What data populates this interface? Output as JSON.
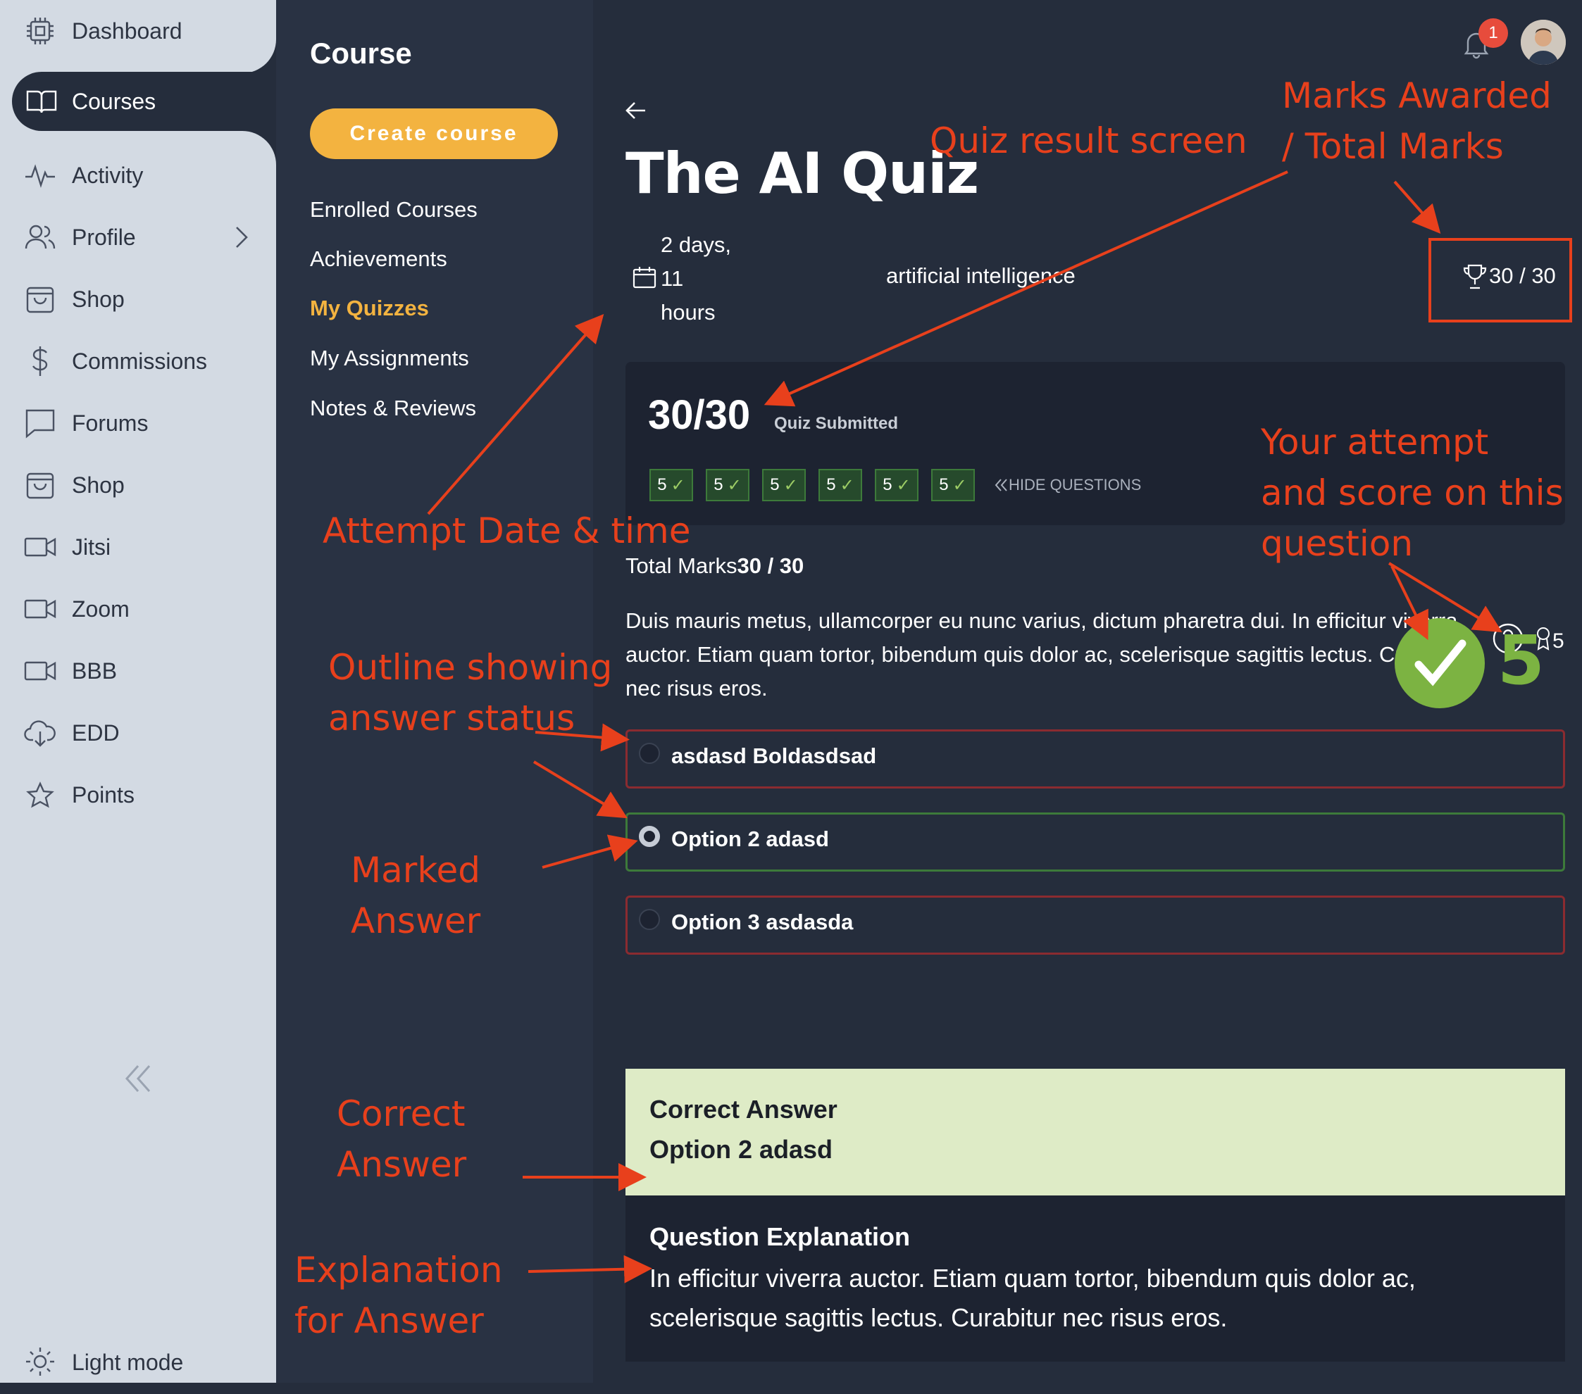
{
  "sidebar": {
    "items": [
      {
        "label": "Dashboard",
        "icon": "chip-icon"
      },
      {
        "label": "Courses",
        "icon": "book-icon",
        "active": true
      },
      {
        "label": "Activity",
        "icon": "pulse-icon"
      },
      {
        "label": "Profile",
        "icon": "users-icon",
        "chevron": "chevron-right-icon"
      },
      {
        "label": "Shop",
        "icon": "bag-icon"
      },
      {
        "label": "Commissions",
        "icon": "dollar-icon"
      },
      {
        "label": "Forums",
        "icon": "chat-icon"
      },
      {
        "label": "Shop",
        "icon": "bag-icon"
      },
      {
        "label": "Jitsi",
        "icon": "video-icon"
      },
      {
        "label": "Zoom",
        "icon": "video-icon"
      },
      {
        "label": "BBB",
        "icon": "video-icon"
      },
      {
        "label": "EDD",
        "icon": "cloud-download-icon"
      },
      {
        "label": "Points",
        "icon": "star-icon"
      }
    ],
    "collapse_icon": "double-chevron-left-icon",
    "light_mode_label": "Light mode"
  },
  "course_menu": {
    "title": "Course",
    "create_button": "Create course",
    "links": [
      "Enrolled Courses",
      "Achievements",
      "My Quizzes",
      "My Assignments",
      "Notes & Reviews"
    ],
    "active_link": "My Quizzes"
  },
  "header": {
    "notification_count": "1"
  },
  "quiz": {
    "title": "The AI Quiz",
    "date_lines": [
      "2 days,",
      "11",
      "hours"
    ],
    "category": "artificial intelligence",
    "marks": "30 / 30",
    "score": "30/30",
    "status": "Quiz Submitted",
    "chips": [
      "5",
      "5",
      "5",
      "5",
      "5",
      "5"
    ],
    "hide_questions": "HIDE QUESTIONS",
    "total_marks_label": "Total Marks",
    "total_marks_value": "30 / 30",
    "question_text": "Duis mauris metus, ullamcorper eu nunc varius, dictum pharetra dui. In efficitur viverra auctor. Etiam quam tortor, bibendum quis dolor ac, scelerisque sagittis lectus. Curabitur nec risus eros.",
    "question_points": "5",
    "big_score": "5",
    "options": [
      {
        "text": "asdasd Boldasdsad",
        "status": "wrong",
        "selected": false
      },
      {
        "text": "Option 2 adasd",
        "status": "correct",
        "selected": true
      },
      {
        "text": "Option 3 asdasda",
        "status": "wrong",
        "selected": false
      }
    ],
    "correct_answer_heading": "Correct Answer",
    "correct_answer_text": "Option 2 adasd",
    "explanation_heading": "Question Explanation",
    "explanation_text": "In efficitur viverra auctor. Etiam quam tortor, bibendum quis dolor ac, scelerisque sagittis lectus. Curabitur nec risus eros."
  },
  "annotations": {
    "quiz_result": "Quiz result screen",
    "marks_awarded": [
      "Marks Awarded",
      "/ Total Marks"
    ],
    "attempt_date": "Attempt Date & time",
    "your_attempt": [
      "Your attempt",
      "and score on this",
      "question"
    ],
    "outline": [
      "Outline showing",
      "answer status"
    ],
    "marked_answer": [
      "Marked",
      "Answer"
    ],
    "correct_answer": [
      "Correct",
      "Answer"
    ],
    "explanation": [
      "Explanation",
      "for Answer"
    ]
  },
  "colors": {
    "accent": "#f3b340",
    "annotation": "#e8401c",
    "correct": "#3d7a3a",
    "wrong": "#8b2b30",
    "check_green": "#7cb342",
    "correct_panel": "#deebc6"
  }
}
